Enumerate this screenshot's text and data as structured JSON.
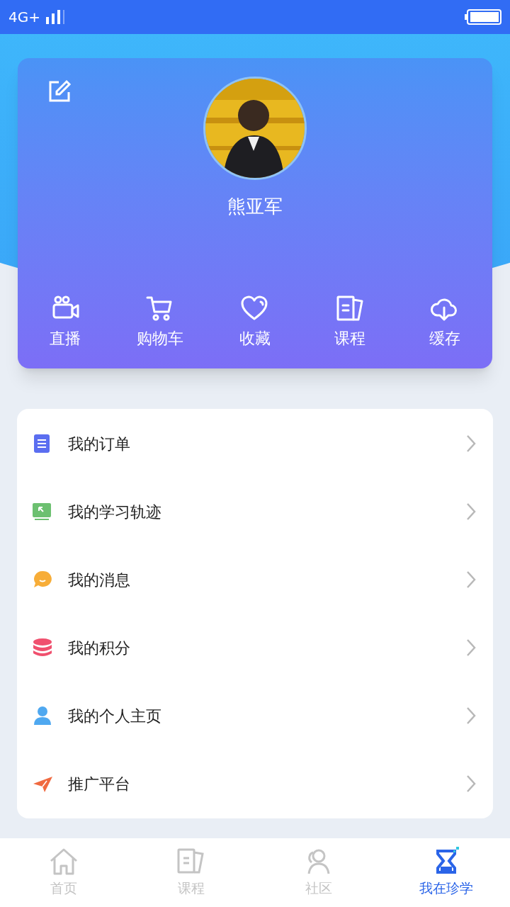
{
  "status_bar": {
    "network": "4G+"
  },
  "profile": {
    "name": "熊亚军"
  },
  "shortcuts": [
    {
      "label": "直播",
      "kind": "video"
    },
    {
      "label": "购物车",
      "kind": "cart"
    },
    {
      "label": "收藏",
      "kind": "heart"
    },
    {
      "label": "课程",
      "kind": "book"
    },
    {
      "label": "缓存",
      "kind": "download"
    }
  ],
  "menu": [
    {
      "label": "我的订单",
      "kind": "order",
      "color": "#5b6ef0"
    },
    {
      "label": "我的学习轨迹",
      "kind": "track",
      "color": "#6cc070"
    },
    {
      "label": "我的消息",
      "kind": "message",
      "color": "#f7ad38"
    },
    {
      "label": "我的积分",
      "kind": "points",
      "color": "#f0506e"
    },
    {
      "label": "我的个人主页",
      "kind": "user",
      "color": "#4fa8f0"
    },
    {
      "label": "推广平台",
      "kind": "send",
      "color": "#f06a40"
    }
  ],
  "tab_bar": [
    {
      "label": "首页",
      "kind": "home",
      "selected": false
    },
    {
      "label": "课程",
      "kind": "book",
      "selected": false
    },
    {
      "label": "社区",
      "kind": "people",
      "selected": false
    },
    {
      "label": "我在珍学",
      "kind": "hourglass",
      "selected": true
    }
  ]
}
